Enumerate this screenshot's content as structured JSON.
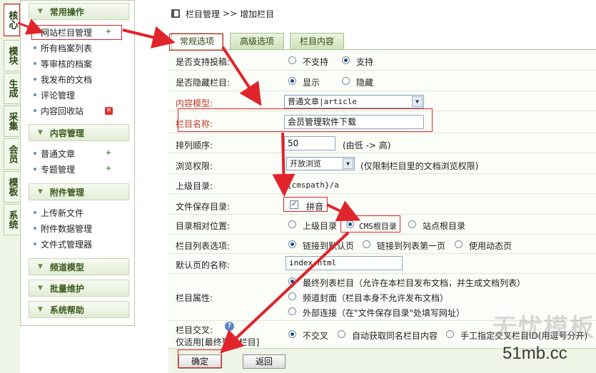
{
  "vertical_tabs": [
    {
      "label": "核心",
      "active": true
    },
    {
      "label": "模块",
      "active": false
    },
    {
      "label": "生成",
      "active": false
    },
    {
      "label": "采集",
      "active": false
    },
    {
      "label": "会员",
      "active": false
    },
    {
      "label": "模板",
      "active": false
    },
    {
      "label": "系统",
      "active": false
    }
  ],
  "sidebar": {
    "groups": [
      {
        "title": "常用操作",
        "items": [
          "网站栏目管理",
          "所有档案列表",
          "等审核的档案",
          "我发布的文档",
          "评论管理",
          "内容回收站"
        ]
      },
      {
        "title": "内容管理",
        "items": [
          "普通文章",
          "专题管理"
        ]
      },
      {
        "title": "附件管理",
        "items": [
          "上传新文件",
          "附件数据管理",
          "文件式管理器"
        ]
      },
      {
        "title": "频道模型",
        "items": []
      },
      {
        "title": "批量维护",
        "items": []
      },
      {
        "title": "系统帮助",
        "items": []
      }
    ]
  },
  "breadcrumb": {
    "part1": "栏目管理",
    "sep": ">>",
    "part2": "增加栏目"
  },
  "tabs": [
    "常规选项",
    "高级选项",
    "栏目内容"
  ],
  "form": {
    "submit_label": {
      "label": "是否支持投稿:",
      "opt1": "不支持",
      "opt2": "支持"
    },
    "hidden_label": {
      "label": "是否隐藏栏目:",
      "opt1": "显示",
      "opt2": "隐藏"
    },
    "model": {
      "label": "内容模型:",
      "value": "普通文章|article"
    },
    "name": {
      "label": "栏目名称:",
      "value": "会员管理软件下载"
    },
    "order": {
      "label": "排列顺序:",
      "value": "50",
      "hint": "(由低 -> 高)"
    },
    "permission": {
      "label": "浏览权限:",
      "value": "开放浏览",
      "hint": "(仅限制栏目里的文档浏览权限)"
    },
    "parent_dir": {
      "label": "上级目录:",
      "value": "{cmspath}/a"
    },
    "save_dir": {
      "label": "文件保存目录:",
      "checkbox": "拼音"
    },
    "relative": {
      "label": "目录相对位置:",
      "opt1": "上级目录",
      "opt2": "CMS根目录",
      "opt3": "站点根目录"
    },
    "list_opt": {
      "label": "栏目列表选项:",
      "opt1": "链接到默认页",
      "opt2": "链接到列表第一页",
      "opt3": "使用动态页"
    },
    "default_page": {
      "label": "默认页的名称:",
      "value": "index.html"
    },
    "attr": {
      "label": "栏目属性:",
      "opt1": "最终列表栏目（允许在本栏目发布文档，并生成文档列表）",
      "opt2": "频道封面（栏目本身不允许发布文档）",
      "opt3": "外部连接（在\"文件保存目录\"处填写网址）"
    },
    "cross": {
      "label": "栏目交叉:",
      "sublabel": "仅适用[最终列表栏目]",
      "opt1": "不交叉",
      "opt2": "自动获取同名栏目内容",
      "opt3": "手工指定交叉栏目ID(用逗号分开)"
    }
  },
  "buttons": {
    "ok": "确定",
    "back": "返回"
  },
  "watermark": {
    "line1": "无忧模板",
    "line2": "51mb.cc"
  }
}
